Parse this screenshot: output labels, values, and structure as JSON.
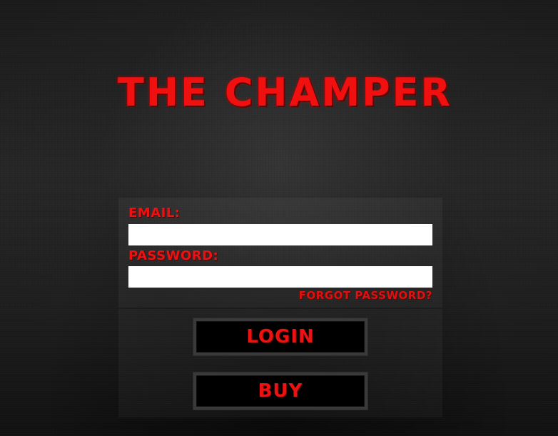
{
  "app": {
    "title": "THE CHAMPER"
  },
  "login_form": {
    "email_label": "EMAIL:",
    "email_value": "",
    "email_placeholder": "",
    "password_label": "PASSWORD:",
    "password_value": "",
    "password_placeholder": "",
    "forgot_password_label": "FORGOT PASSWORD?"
  },
  "actions": {
    "login_label": "LOGIN",
    "buy_label": "BUY"
  },
  "colors": {
    "accent": "#ee1111",
    "background": "#1e1e1e",
    "input_background": "#ffffff",
    "button_background": "#000000",
    "button_border": "#3a3a3a"
  }
}
